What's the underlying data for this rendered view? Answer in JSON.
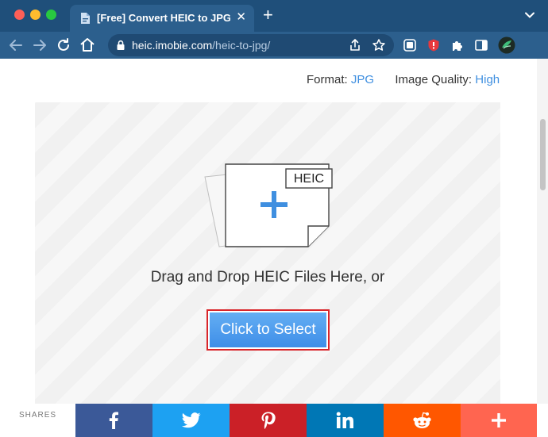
{
  "browser": {
    "tab_title": "[Free] Convert HEIC to JPG/PN",
    "tab_close": "✕",
    "new_tab": "+",
    "url_domain": "heic.imobie.com",
    "url_path": "/heic-to-jpg/"
  },
  "page": {
    "format_label": "Format:",
    "format_value": "JPG",
    "quality_label": "Image Quality:",
    "quality_value": "High",
    "file_badge": "HEIC",
    "drop_text": "Drag and Drop HEIC Files Here, or",
    "select_button": "Click to Select"
  },
  "sharebar": {
    "label": "SHARES",
    "buttons": [
      {
        "name": "facebook",
        "color": "#3b5998"
      },
      {
        "name": "twitter",
        "color": "#1da1f2"
      },
      {
        "name": "pinterest",
        "color": "#cb2027"
      },
      {
        "name": "linkedin",
        "color": "#0077b5"
      },
      {
        "name": "reddit",
        "color": "#ff5700"
      },
      {
        "name": "more",
        "color": "#ff6550"
      }
    ]
  },
  "colors": {
    "accent": "#3f8fe0",
    "chrome": "#2c5f8d",
    "highlight": "#d9262b"
  }
}
